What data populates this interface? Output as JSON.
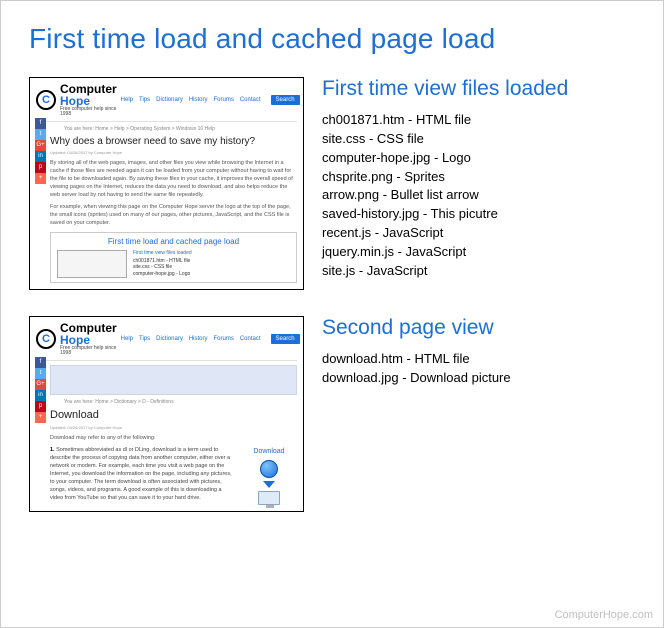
{
  "title": "First time load and cached page load",
  "watermark": "ComputerHope.com",
  "thumbs": {
    "brand_a": "Computer ",
    "brand_b": "Hope",
    "tagline": "Free computer help since 1998",
    "nav": [
      "Help",
      "Tips",
      "Dictionary",
      "History",
      "Forums",
      "Contact"
    ],
    "search": "Search",
    "first": {
      "crumb": "You are here: Home > Help > Operating System > Windows 10 Help",
      "heading": "Why does a browser need to save my history?",
      "meta": "Updated: 04/26/2017 by Computer Hope",
      "p1": "By storing all of the web pages, images, and other files you view while browsing the Internet in a cache if those files are needed again it can be loaded from your computer without having to wait for the file to be downloaded again. By saving these files in your cache, it improves the overall speed of viewing pages on the Internet, reduces the data you need to download, and also helps reduce the web server load by not having to send the same file repeatedly.",
      "p2": "For example, when viewing this page on the Computer Hope server the logo at the top of the page, the small icons (sprites) used on many of our pages, other pictures, JavaScript, and the CSS file is saved on your computer.",
      "inset_title": "First time load and cached page load",
      "inset_side_title": "First time view files loaded",
      "inset_lines": "ch001871.htm - HTML file\nsite.css - CSS file\ncomputer-hope.jpg - Logo"
    },
    "second": {
      "crumb": "You are here: Home > Dictionary > D - Definitions",
      "heading": "Download",
      "meta": "Updated: 04/26/2017 by Computer Hope",
      "lead": "Download may refer to any of the following:",
      "ol_num": "1.",
      "ol_text": "Sometimes abbreviated as dl or DLing, download is a term used to describe the process of copying data from another computer, either over a network or modem. For example, each time you visit a web page on the Internet, you download the information on the page, including any pictures, to your computer. The term download is often associated with pictures, songs, videos, and programs. A good example of this is downloading a video from YouTube so that you can save it to your hard drive.",
      "dl_label": "Download"
    }
  },
  "sections": {
    "first": {
      "title": "First time view files loaded",
      "files": [
        "ch001871.htm - HTML file",
        "site.css - CSS file",
        "computer-hope.jpg - Logo",
        "chsprite.png - Sprites",
        "arrow.png - Bullet list arrow",
        "saved-history.jpg - This picutre",
        "recent.js - JavaScript",
        "jquery.min.js - JavaScript",
        "site.js - JavaScript"
      ]
    },
    "second": {
      "title": "Second page view",
      "files": [
        "download.htm - HTML file",
        "download.jpg - Download picture"
      ]
    }
  }
}
